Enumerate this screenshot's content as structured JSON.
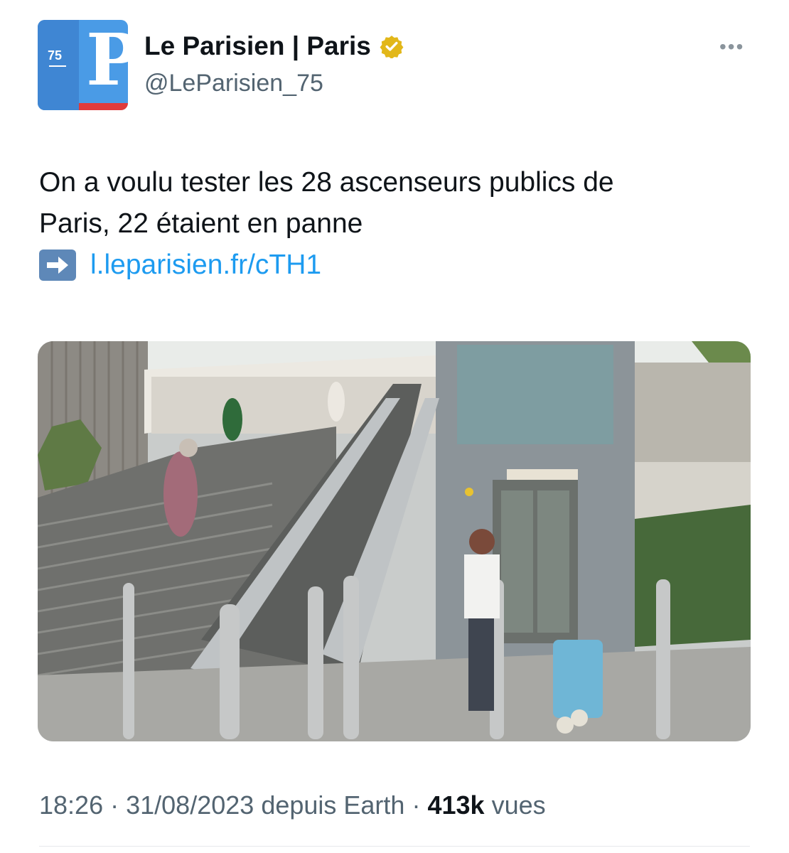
{
  "account": {
    "avatar_number": "75",
    "avatar_letter": "P",
    "display_name": "Le Parisien | Paris",
    "handle": "@LeParisien_75",
    "more_label": "•••"
  },
  "tweet": {
    "text_line1": "On a voulu tester les 28 ascenseurs publics de",
    "text_line2": "Paris, 22 étaient en panne",
    "link_text": "l.leparisien.fr/cTH1"
  },
  "meta": {
    "time": "18:26",
    "date": "31/08/2023",
    "source": "depuis Earth",
    "views_count": "413k",
    "views_label": "vues"
  },
  "colors": {
    "link": "#1d9bf0",
    "badge": "#e2b719",
    "avatar_blue": "#4a9be6",
    "avatar_red": "#e03b3b"
  }
}
